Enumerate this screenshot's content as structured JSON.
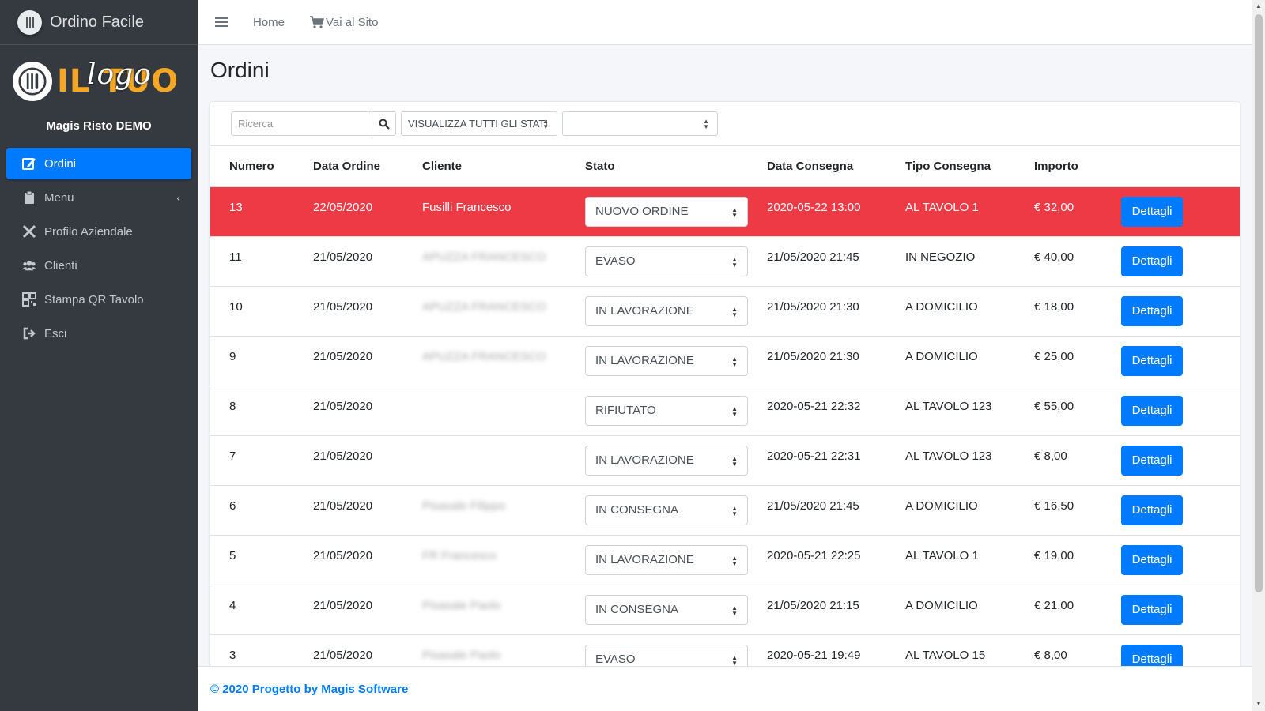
{
  "app": {
    "brand_name": "Ordino Facile",
    "logo_text": "IL TUO",
    "logo_script": "logo",
    "org_name": "Magis Risto DEMO"
  },
  "sidebar": {
    "items": [
      {
        "label": "Ordini",
        "icon": "edit-icon",
        "active": true
      },
      {
        "label": "Menu",
        "icon": "clipboard-icon"
      },
      {
        "label": "Profilo Aziendale",
        "icon": "tools-icon"
      },
      {
        "label": "Clienti",
        "icon": "users-icon"
      },
      {
        "label": "Stampa QR Tavolo",
        "icon": "qrcode-icon"
      },
      {
        "label": "Esci",
        "icon": "sign-out-icon"
      }
    ]
  },
  "topbar": {
    "home_label": "Home",
    "site_label": "Vai al Sito"
  },
  "page": {
    "title": "Ordini"
  },
  "filters": {
    "search_placeholder": "Ricerca",
    "status_filter_value": "VISUALIZZA TUTTI GLI STATI",
    "other_filter_value": ""
  },
  "table": {
    "headers": [
      "Numero",
      "Data Ordine",
      "Cliente",
      "Stato",
      "Data Consegna",
      "Tipo Consegna",
      "Importo"
    ],
    "details_label": "Dettagli",
    "rows": [
      {
        "numero": "13",
        "data_ordine": "22/05/2020",
        "cliente": "Fusilli Francesco",
        "stato": "NUOVO ORDINE",
        "data_consegna": "2020-05-22 13:00",
        "tipo_consegna": "AL TAVOLO 1",
        "importo": "€ 32,00"
      },
      {
        "numero": "11",
        "data_ordine": "21/05/2020",
        "cliente": "APUZZA FRANCESCO",
        "stato": "EVASO",
        "data_consegna": "21/05/2020 21:45",
        "tipo_consegna": "IN NEGOZIO",
        "importo": "€ 40,00"
      },
      {
        "numero": "10",
        "data_ordine": "21/05/2020",
        "cliente": "APUZZA FRANCESCO",
        "stato": "IN LAVORAZIONE",
        "data_consegna": "21/05/2020 21:30",
        "tipo_consegna": "A DOMICILIO",
        "importo": "€ 18,00"
      },
      {
        "numero": "9",
        "data_ordine": "21/05/2020",
        "cliente": "APUZZA FRANCESCO",
        "stato": "IN LAVORAZIONE",
        "data_consegna": "21/05/2020 21:30",
        "tipo_consegna": "A DOMICILIO",
        "importo": "€ 25,00"
      },
      {
        "numero": "8",
        "data_ordine": "21/05/2020",
        "cliente": "",
        "stato": "RIFIUTATO",
        "data_consegna": "2020-05-21 22:32",
        "tipo_consegna": "AL TAVOLO 123",
        "importo": "€ 55,00"
      },
      {
        "numero": "7",
        "data_ordine": "21/05/2020",
        "cliente": "",
        "stato": "IN LAVORAZIONE",
        "data_consegna": "2020-05-21 22:31",
        "tipo_consegna": "AL TAVOLO 123",
        "importo": "€ 8,00"
      },
      {
        "numero": "6",
        "data_ordine": "21/05/2020",
        "cliente": "Pisasale Filippo",
        "stato": "IN CONSEGNA",
        "data_consegna": "21/05/2020 21:45",
        "tipo_consegna": "A DOMICILIO",
        "importo": "€ 16,50"
      },
      {
        "numero": "5",
        "data_ordine": "21/05/2020",
        "cliente": "FR Francesco",
        "stato": "IN LAVORAZIONE",
        "data_consegna": "2020-05-21 22:25",
        "tipo_consegna": "AL TAVOLO 1",
        "importo": "€ 19,00"
      },
      {
        "numero": "4",
        "data_ordine": "21/05/2020",
        "cliente": "Pisasale Paolo",
        "stato": "IN CONSEGNA",
        "data_consegna": "21/05/2020 21:15",
        "tipo_consegna": "A DOMICILIO",
        "importo": "€ 21,00"
      },
      {
        "numero": "3",
        "data_ordine": "21/05/2020",
        "cliente": "Pisasale Paolo",
        "stato": "EVASO",
        "data_consegna": "2020-05-21 19:49",
        "tipo_consegna": "AL TAVOLO 15",
        "importo": "€ 8,00"
      }
    ]
  },
  "footer": {
    "text": "© 2020 Progetto by Magis Software"
  },
  "colors": {
    "accent": "#007bff",
    "highlight_row": "#ee3a44",
    "sidebar_bg": "#343a40",
    "logo_orange": "#f5a623"
  }
}
